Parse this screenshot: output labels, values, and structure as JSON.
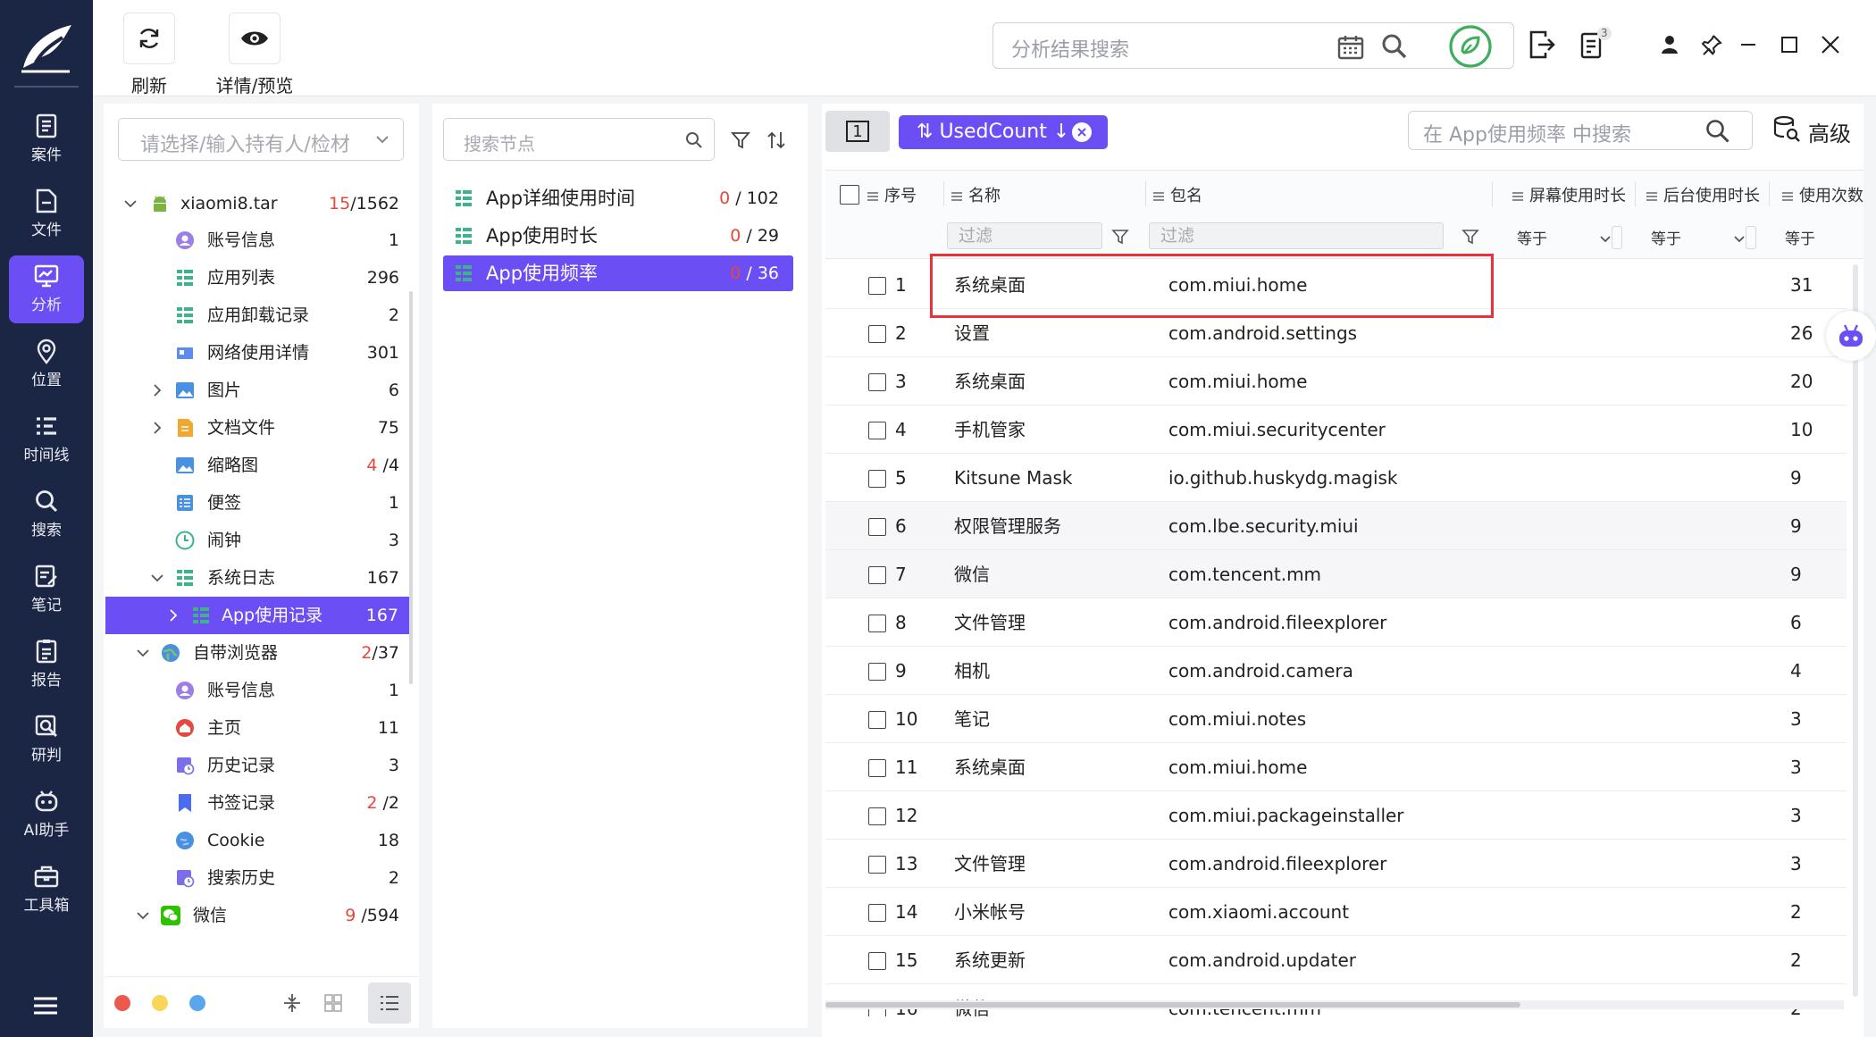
{
  "toolbar": {
    "refresh_label": "刷新",
    "detail_label": "详情/预览",
    "search_placeholder": "分析结果搜索",
    "badge_count": "3"
  },
  "nav": {
    "items": [
      {
        "label": "案件",
        "icon": "case-icon"
      },
      {
        "label": "文件",
        "icon": "file-icon"
      },
      {
        "label": "分析",
        "icon": "analysis-icon"
      },
      {
        "label": "位置",
        "icon": "location-icon"
      },
      {
        "label": "时间线",
        "icon": "timeline-icon"
      },
      {
        "label": "搜索",
        "icon": "search-icon"
      },
      {
        "label": "笔记",
        "icon": "note-icon"
      },
      {
        "label": "报告",
        "icon": "report-icon"
      },
      {
        "label": "研判",
        "icon": "judge-icon"
      },
      {
        "label": "AI助手",
        "icon": "ai-robot-icon"
      },
      {
        "label": "工具箱",
        "icon": "toolbox-icon"
      }
    ],
    "active": "分析"
  },
  "tree": {
    "holder_placeholder": "请选择/输入持有人/检材",
    "rows": [
      {
        "label": "xiaomi8.tar",
        "red": "15",
        "total": "/1562"
      },
      {
        "label": "账号信息",
        "red": "",
        "total": "1"
      },
      {
        "label": "应用列表",
        "red": "",
        "total": "296"
      },
      {
        "label": "应用卸载记录",
        "red": "",
        "total": "2"
      },
      {
        "label": "网络使用详情",
        "red": "",
        "total": "301"
      },
      {
        "label": "图片",
        "red": "",
        "total": "6"
      },
      {
        "label": "文档文件",
        "red": "",
        "total": "75"
      },
      {
        "label": "缩略图",
        "red": "4",
        "total": "/4"
      },
      {
        "label": "便签",
        "red": "",
        "total": "1"
      },
      {
        "label": "闹钟",
        "red": "",
        "total": "3"
      },
      {
        "label": "系统日志",
        "red": "",
        "total": "167"
      },
      {
        "label": "App使用记录",
        "red": "",
        "total": "167"
      },
      {
        "label": "自带浏览器",
        "red": "2",
        "total": "/37"
      },
      {
        "label": "账号信息",
        "red": "",
        "total": "1"
      },
      {
        "label": "主页",
        "red": "",
        "total": "11"
      },
      {
        "label": "历史记录",
        "red": "",
        "total": "3"
      },
      {
        "label": "书签记录",
        "red": "2",
        "total": "/2"
      },
      {
        "label": "Cookie",
        "red": "",
        "total": "18"
      },
      {
        "label": "搜索历史",
        "red": "",
        "total": "2"
      },
      {
        "label": "微信",
        "red": "9",
        "total": "/594"
      }
    ]
  },
  "nodes": {
    "search_placeholder": "搜索节点",
    "items": [
      {
        "label": "App详细使用时间",
        "red": "0",
        "total": "/ 102"
      },
      {
        "label": "App使用时长",
        "red": "0",
        "total": "/ 29"
      },
      {
        "label": "App使用频率",
        "red": "0",
        "total": "/ 36"
      }
    ]
  },
  "table": {
    "page_indicator": "1",
    "sort_chip": "UsedCount",
    "search_placeholder": "在 App使用频率 中搜索",
    "advanced_label": "高级",
    "headers": {
      "no": "序号",
      "name": "名称",
      "package": "包名",
      "screen_time": "屏幕使用时长",
      "bg_time": "后台使用时长",
      "use_count": "使用次数"
    },
    "filter_placeholder": "过滤",
    "equals_label": "等于",
    "rows": [
      {
        "no": "1",
        "name": "系统桌面",
        "package": "com.miui.home",
        "count": "31"
      },
      {
        "no": "2",
        "name": "设置",
        "package": "com.android.settings",
        "count": "26"
      },
      {
        "no": "3",
        "name": "系统桌面",
        "package": "com.miui.home",
        "count": "20"
      },
      {
        "no": "4",
        "name": "手机管家",
        "package": "com.miui.securitycenter",
        "count": "10"
      },
      {
        "no": "5",
        "name": "Kitsune Mask",
        "package": "io.github.huskydg.magisk",
        "count": "9"
      },
      {
        "no": "6",
        "name": "权限管理服务",
        "package": "com.lbe.security.miui",
        "count": "9"
      },
      {
        "no": "7",
        "name": "微信",
        "package": "com.tencent.mm",
        "count": "9"
      },
      {
        "no": "8",
        "name": "文件管理",
        "package": "com.android.fileexplorer",
        "count": "6"
      },
      {
        "no": "9",
        "name": "相机",
        "package": "com.android.camera",
        "count": "4"
      },
      {
        "no": "10",
        "name": "笔记",
        "package": "com.miui.notes",
        "count": "3"
      },
      {
        "no": "11",
        "name": "系统桌面",
        "package": "com.miui.home",
        "count": "3"
      },
      {
        "no": "12",
        "name": "",
        "package": "com.miui.packageinstaller",
        "count": "3"
      },
      {
        "no": "13",
        "name": "文件管理",
        "package": "com.android.fileexplorer",
        "count": "3"
      },
      {
        "no": "14",
        "name": "小米帐号",
        "package": "com.xiaomi.account",
        "count": "2"
      },
      {
        "no": "15",
        "name": "系统更新",
        "package": "com.android.updater",
        "count": "2"
      },
      {
        "no": "16",
        "name": "微信",
        "package": "com.tencent.mm",
        "count": "2"
      }
    ]
  },
  "colors": {
    "accent": "#6c4ef5",
    "nav_bg": "#1b2544",
    "highlight": "#e7323b",
    "count_red": "#e5483c"
  }
}
